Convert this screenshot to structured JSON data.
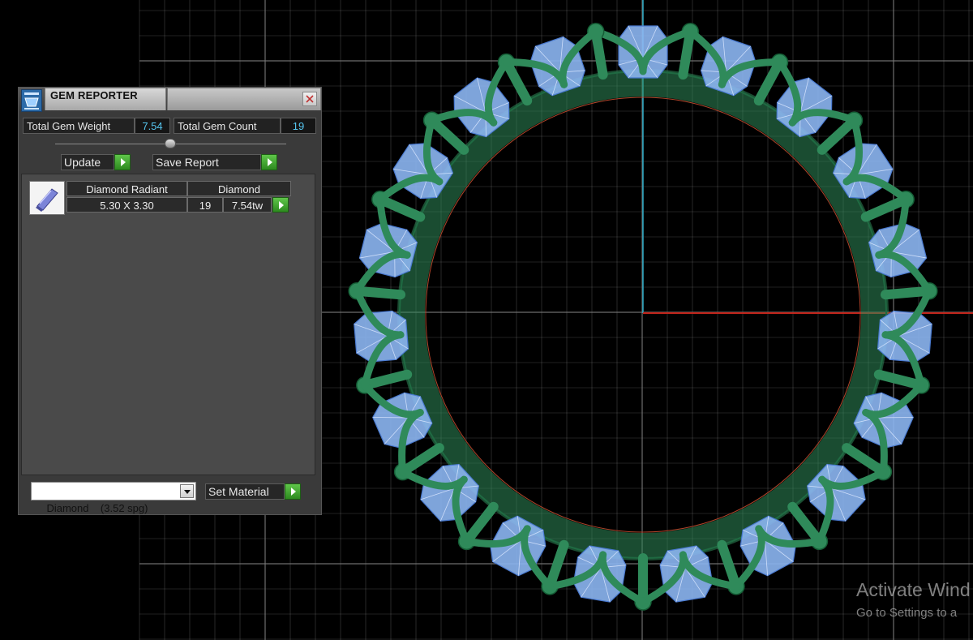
{
  "panel": {
    "title": "GEM REPORTER",
    "total_weight_label": "Total Gem Weight",
    "total_weight_value": "7.54",
    "total_count_label": "Total Gem Count",
    "total_count_value": "19",
    "update_label": "Update",
    "save_report_label": "Save Report"
  },
  "gem_list": {
    "rows": [
      {
        "shape": "Diamond Radiant",
        "material": "Diamond",
        "size": "5.30 X 3.30",
        "count": "19",
        "weight": "7.54tw"
      }
    ]
  },
  "material": {
    "selected": "Diamond    (3.52 spg)",
    "set_label": "Set Material"
  },
  "watermark": {
    "title": "Activate Wind",
    "subtitle": "Go to Settings to a"
  },
  "colors": {
    "background": "#000000",
    "grid": "#7a7a7a",
    "y_axis": "#2aa8c4",
    "x_axis": "#c0241a",
    "metal": "#2f8a5a",
    "gem": "#8cb6f2",
    "value_text": "#56c6f0"
  },
  "icons": [
    "app-icon",
    "close-icon",
    "gem-thumbnail-icon",
    "play-arrow-icon",
    "dropdown-arrow-icon"
  ]
}
